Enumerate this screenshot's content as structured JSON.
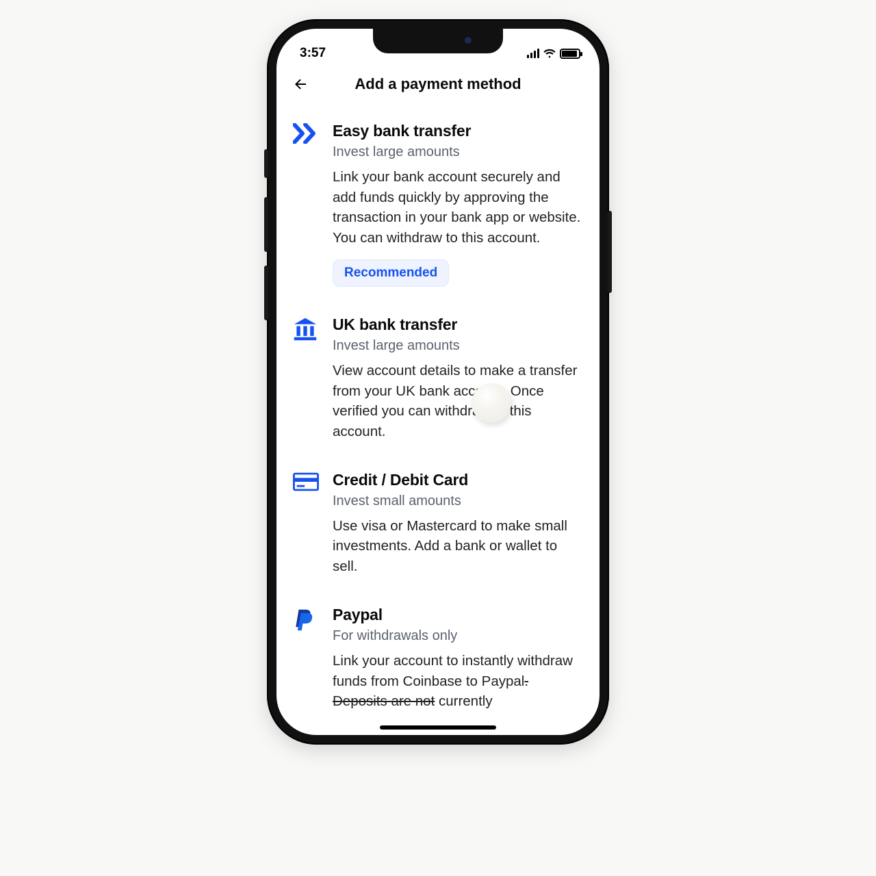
{
  "status": {
    "time": "3:57"
  },
  "colors": {
    "accent": "#1652f0"
  },
  "header": {
    "title": "Add a payment method"
  },
  "methods": [
    {
      "id": "easy-bank",
      "title": "Easy bank transfer",
      "subtitle": "Invest large amounts",
      "description": "Link your bank account securely and add funds quickly by approving the transaction in your bank app or website. You can withdraw to this account.",
      "badge": "Recommended"
    },
    {
      "id": "uk-bank",
      "title": "UK bank transfer",
      "subtitle": "Invest large amounts",
      "description": "View account details to make a transfer from your UK bank account. Once verified you can withdraw to this account."
    },
    {
      "id": "card",
      "title": "Credit / Debit Card",
      "subtitle": "Invest small amounts",
      "description": "Use visa or Mastercard to make small investments. Add a bank or wallet to sell."
    },
    {
      "id": "paypal",
      "title": "Paypal",
      "subtitle": "For withdrawals only",
      "desc_pre": "Link your account to instantly withdraw funds from Coinbase to Paypal",
      "desc_strike": ". Deposits are not",
      "desc_post": " currently"
    }
  ]
}
